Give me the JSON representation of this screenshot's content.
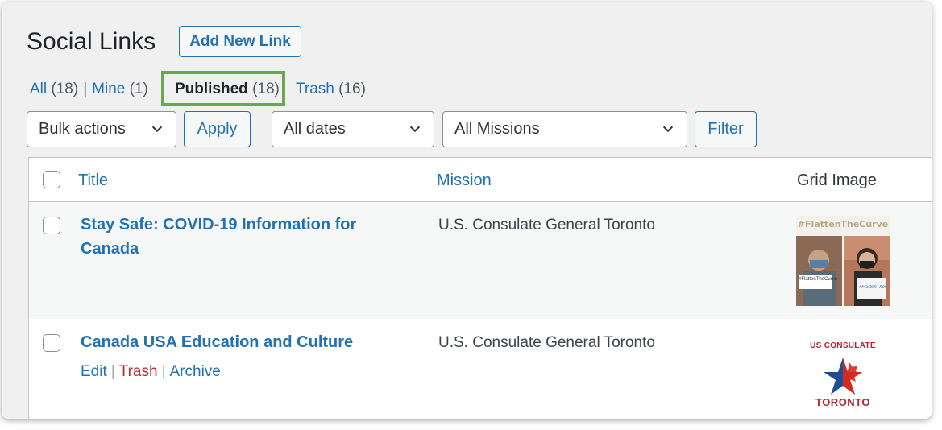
{
  "page": {
    "title": "Social Links",
    "add_new_label": "Add New Link"
  },
  "views": {
    "all_label": "All",
    "all_count": "(18)",
    "mine_label": "Mine",
    "mine_count": "(1)",
    "published_label": "Published",
    "published_count": "(18)",
    "trash_label": "Trash",
    "trash_count": "(16)",
    "separator": "|"
  },
  "filters": {
    "bulk_actions": "Bulk actions",
    "apply_label": "Apply",
    "dates": "All dates",
    "missions": "All Missions",
    "filter_label": "Filter"
  },
  "table": {
    "columns": [
      "Title",
      "Mission",
      "Grid Image"
    ],
    "rows": [
      {
        "title": "Stay Safe: COVID-19 Information for Canada",
        "mission": "U.S. Consulate General Toronto",
        "image_caption": "#FlattenTheCurve",
        "image_sign_left": "#FlattenTheCurve",
        "image_sign_right": "#FlattenTheCurve"
      },
      {
        "title": "Canada USA Education and Culture",
        "mission": "U.S. Consulate General Toronto",
        "actions": {
          "edit": "Edit",
          "trash": "Trash",
          "archive": "Archive",
          "sep": "|"
        },
        "image_top": "US CONSULATE",
        "image_bottom": "TORONTO"
      }
    ]
  },
  "colors": {
    "link": "#2271b1",
    "highlight": "#6aa84f",
    "trash": "#b32d2e"
  }
}
